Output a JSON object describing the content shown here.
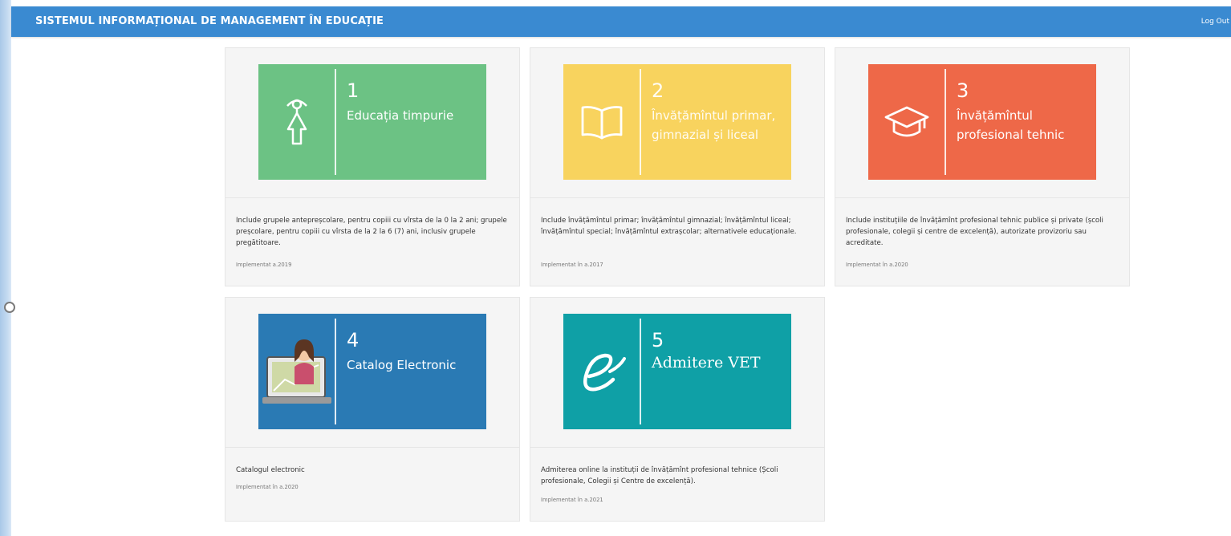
{
  "header": {
    "title": "SISTEMUL INFORMAȚIONAL DE MANAGEMENT ÎN EDUCAȚIE",
    "logout_label": "Log Out"
  },
  "cards": [
    {
      "number": "1",
      "name": "Educația timpurie",
      "description": "Include grupele antepreșcolare, pentru copiii cu vîrsta de la 0 la 2 ani; grupele preșcolare, pentru copiii cu vîrsta de la 2 la 6 (7) ani, inclusiv grupele pregătitoare.",
      "implemented": "Implementat a.2019",
      "color": "#6cc284",
      "icon": "child-icon"
    },
    {
      "number": "2",
      "name": "Învățămîntul primar, gimnazial și liceal",
      "description": "Include învățămîntul primar; învățămîntul gimnazial; învățămîntul liceal; învățămîntul special; învățămîntul extrașcolar; alternativele educaționale.",
      "implemented": "Implementat în a.2017",
      "color": "#f8d35e",
      "icon": "open-book-icon"
    },
    {
      "number": "3",
      "name": "Învățămîntul profesional tehnic",
      "description": "Include instituțiile de învățămînt profesional tehnic publice și private (școli profesionale, colegii și centre de excelență), autorizate provizoriu sau acreditate.",
      "implemented": "Implementat în a.2020",
      "color": "#ee6848",
      "icon": "graduation-cap-icon"
    },
    {
      "number": "4",
      "name": "Catalog Electronic",
      "description": "Catalogul electronic",
      "implemented": "Implementat în a.2020",
      "color": "#2a7ab4",
      "icon": "teacher-laptop-icon"
    },
    {
      "number": "5",
      "name": "Admitere VET",
      "description": "Admiterea online la instituții de învățămînt profesional tehnice (Școli profesionale, Colegii și Centre de excelență).",
      "implemented": "Implementat în a.2021",
      "color": "#0fa0a6",
      "icon": "e-letter-icon"
    }
  ]
}
